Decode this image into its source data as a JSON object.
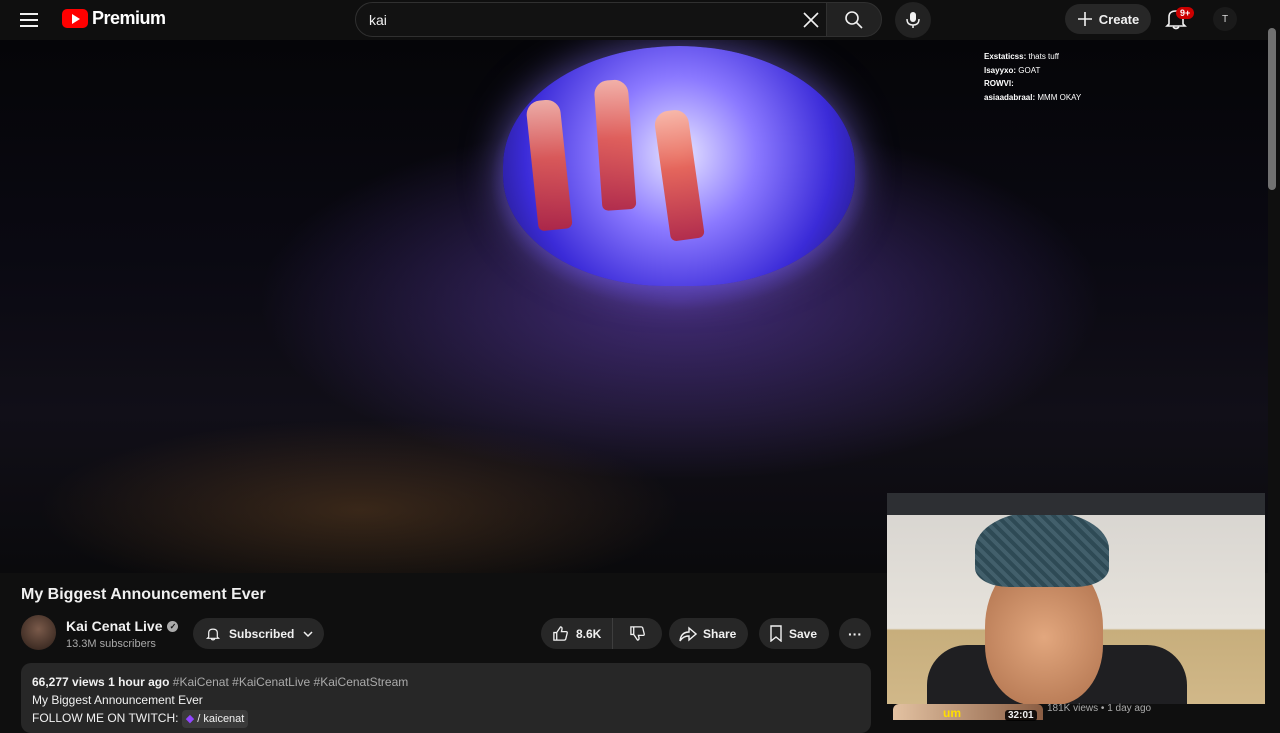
{
  "header": {
    "logo_text": "Premium",
    "search_value": "kai",
    "create_label": "Create",
    "notification_badge": "9+",
    "avatar_letter": "T"
  },
  "player": {
    "chat": [
      {
        "user": "Exstaticss:",
        "message": "thats tuff"
      },
      {
        "user": "lsayyxo:",
        "message": "GOAT"
      },
      {
        "user": "ROWVI:",
        "message": ""
      },
      {
        "user": "asiaadabraal:",
        "message": "MMM OKAY"
      }
    ]
  },
  "video": {
    "title": "My Biggest Announcement Ever",
    "channel_name": "Kai Cenat Live",
    "subscribers": "13.3M subscribers",
    "subscribe_label": "Subscribed",
    "likes": "8.6K",
    "share_label": "Share",
    "save_label": "Save"
  },
  "description": {
    "views": "66,277 views",
    "age": "1 hour ago",
    "tags": "#KaiCenat #KaiCenatLive #KaiCenatStream",
    "line1": "My Biggest Announcement Ever",
    "line2_prefix": "FOLLOW ME ON TWITCH:",
    "twitch_handle": "/ kaicenat"
  },
  "recommendation": {
    "thumb_text": "um",
    "duration": "32:01",
    "meta": "181K views • 1 day ago"
  },
  "colors": {
    "background": "#0f0f0f",
    "accent": "#ff0000",
    "pill": "#272727"
  }
}
